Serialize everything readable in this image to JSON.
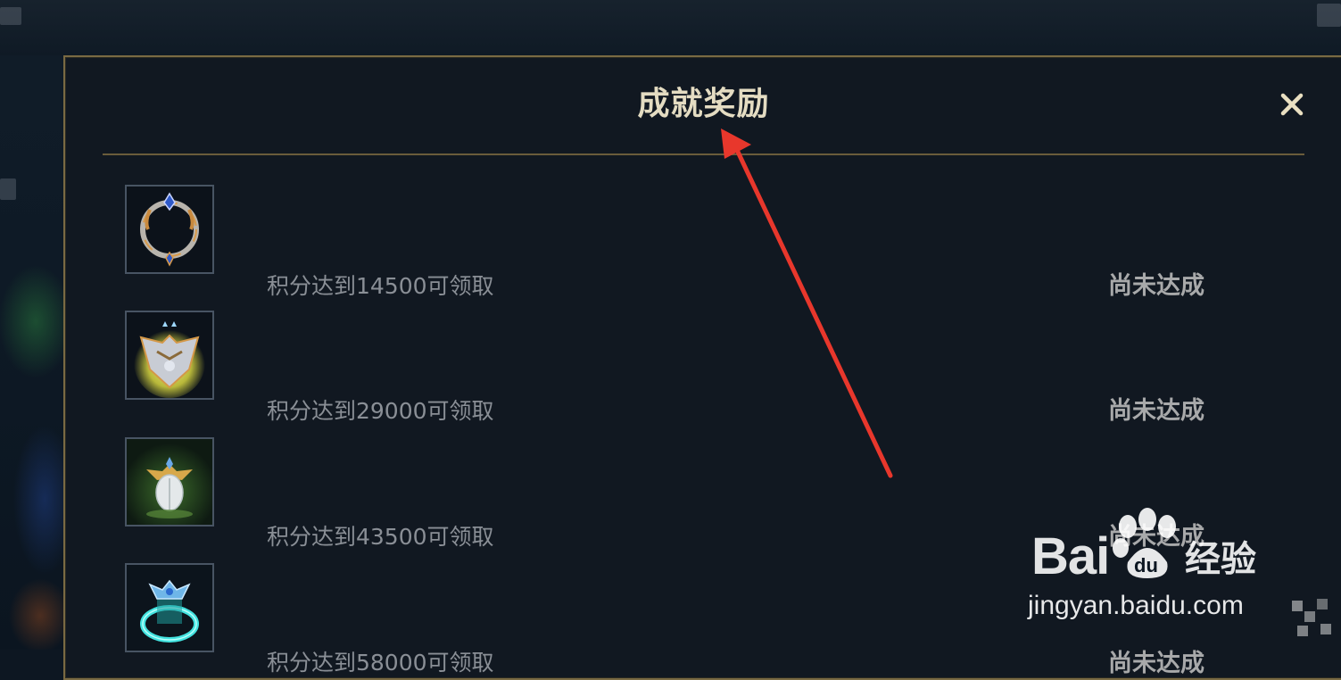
{
  "modal": {
    "title": "成就奖励",
    "close_icon": "close-icon",
    "accent_color": "#7a6a43"
  },
  "rewards": [
    {
      "icon": "ring-frame-icon",
      "requirement": "积分达到14500可领取",
      "status": "尚未达成"
    },
    {
      "icon": "winged-crest-icon",
      "requirement": "积分达到29000可领取",
      "status": "尚未达成"
    },
    {
      "icon": "leaf-emblem-icon",
      "requirement": "积分达到43500可领取",
      "status": "尚未达成"
    },
    {
      "icon": "teleport-ring-icon",
      "requirement": "积分达到58000可领取",
      "status": "尚未达成"
    }
  ],
  "annotation": {
    "type": "arrow",
    "color": "#e8372c"
  },
  "watermark": {
    "brand_left": "Bai",
    "brand_right": "du",
    "product": "经验",
    "url": "jingyan.baidu.com"
  }
}
